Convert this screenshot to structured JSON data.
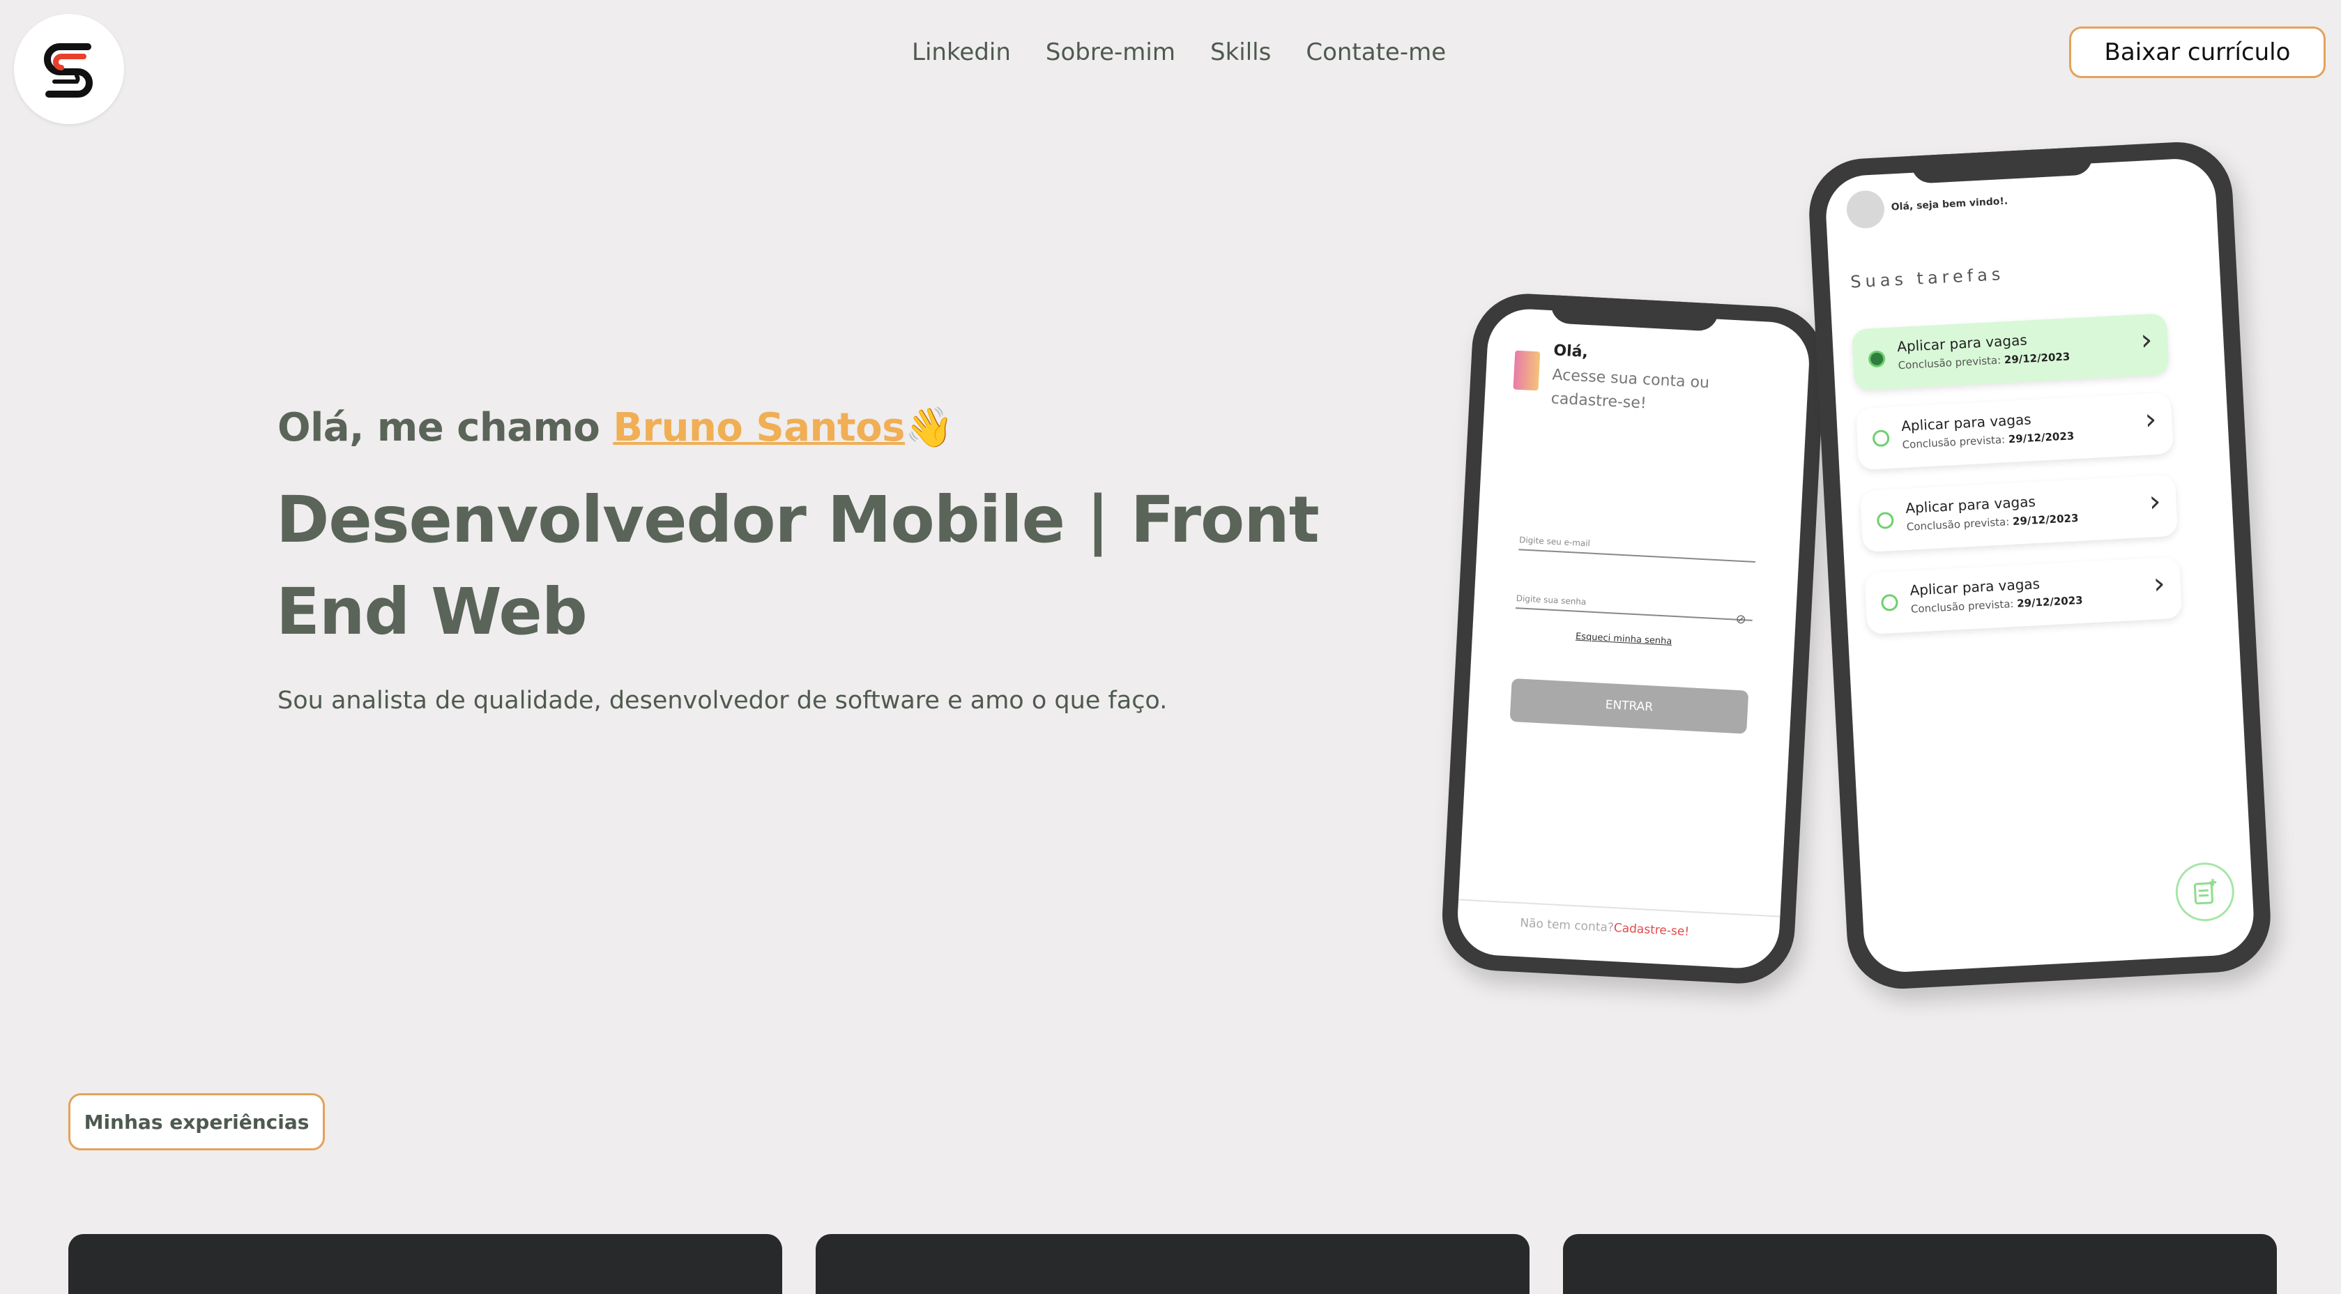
{
  "header": {
    "logo_icon": "s-monogram-logo-icon",
    "nav": [
      "Linkedin",
      "Sobre-mim",
      "Skills",
      "Contate-me"
    ],
    "cv_button": "Baixar currículo"
  },
  "hero": {
    "greeting_prefix": "Olá, me chamo ",
    "name": "Bruno Santos",
    "wave": "👋",
    "title": "Desenvolvedor Mobile | Front End Web",
    "subtitle": "Sou analista de qualidade, desenvolvedor de software e amo o que faço."
  },
  "phone_login": {
    "hello": "Olá,",
    "text": "Acesse sua conta ou cadastre-se!",
    "email_label": "Digite seu e-mail",
    "password_label": "Digite sua senha",
    "forgot": "Esqueci minha senha",
    "button": "ENTRAR",
    "footer_prefix": "Não tem conta?",
    "footer_link": "Cadastre-se!"
  },
  "phone_tasks": {
    "welcome": "Olá, seja bem vindo!.",
    "title": "Suas tarefas",
    "tasks": [
      {
        "name": "Aplicar para vagas",
        "date_label": "Conclusão prevista:",
        "date": "29/12/2023",
        "done": true
      },
      {
        "name": "Aplicar para vagas",
        "date_label": "Conclusão prevista:",
        "date": "29/12/2023",
        "done": false
      },
      {
        "name": "Aplicar para vagas",
        "date_label": "Conclusão prevista:",
        "date": "29/12/2023",
        "done": false
      },
      {
        "name": "Aplicar para vagas",
        "date_label": "Conclusão prevista:",
        "date": "29/12/2023",
        "done": false
      }
    ]
  },
  "experiences": {
    "button": "Minhas experiências"
  },
  "colors": {
    "accent": "#f0ae55",
    "text": "#5a6459",
    "background": "#efeded",
    "card": "#28292b"
  }
}
